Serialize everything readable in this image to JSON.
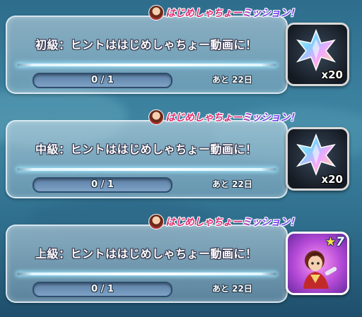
{
  "banner_text": "はじめしゃちょーミッション！",
  "missions": [
    {
      "title": "初級：ヒントははじめしゃちょー動画に！",
      "progress_text": "0 / 1",
      "progress_value": 0,
      "days_left": "あと 22日",
      "reward": {
        "icon": "star-gem-icon",
        "quantity": "x20"
      }
    },
    {
      "title": "中級：ヒントははじめしゃちょー動画に！",
      "progress_text": "0 / 1",
      "progress_value": 0,
      "days_left": "あと 22日",
      "reward": {
        "icon": "star-gem-icon",
        "quantity": "x20"
      }
    },
    {
      "title": "上級：ヒントははじめしゃちょー動画に！",
      "progress_text": "0 / 1",
      "progress_value": 0,
      "days_left": "あと 22日",
      "reward": {
        "icon": "character-portrait-icon",
        "rarity": "7"
      }
    }
  ],
  "colors": {
    "banner_pink": "#e03070",
    "banner_purple": "#6a40f0",
    "glow": "#dff6ff",
    "progress_track": "#7ea3c6"
  }
}
